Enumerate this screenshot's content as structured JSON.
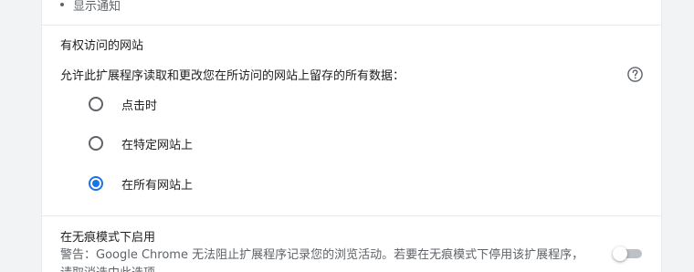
{
  "top_item": {
    "label": "显示通知"
  },
  "site_access": {
    "title": "有权访问的网站",
    "description": "允许此扩展程序读取和更改您在所访问的网站上留存的所有数据：",
    "help_icon": "help-circle-icon",
    "options": [
      {
        "label": "点击时",
        "selected": false
      },
      {
        "label": "在特定网站上",
        "selected": false
      },
      {
        "label": "在所有网站上",
        "selected": true
      }
    ]
  },
  "incognito": {
    "title": "在无痕模式下启用",
    "warning": "警告：Google Chrome 无法阻止扩展程序记录您的浏览活动。若要在无痕模式下停用该扩展程序，请取消选中此选项。",
    "enabled": false
  },
  "colors": {
    "accent": "#1a73e8",
    "text": "#202124",
    "secondary": "#5f6368",
    "divider": "#e8eaed"
  }
}
